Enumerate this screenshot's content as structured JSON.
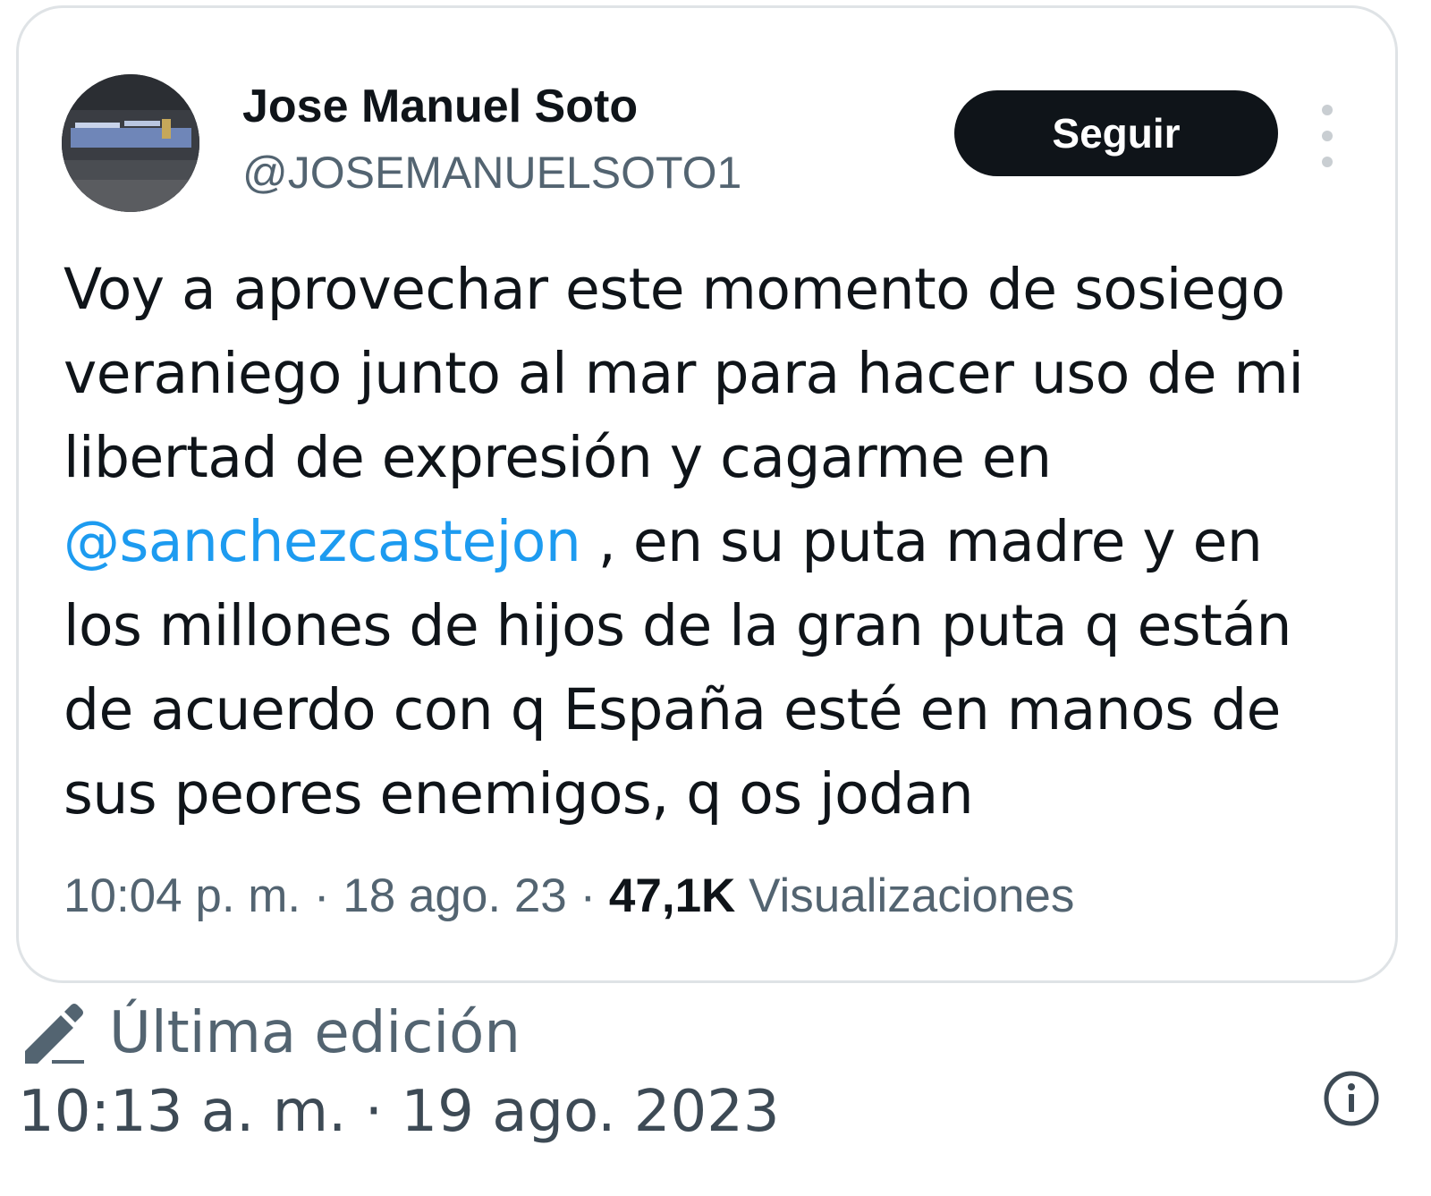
{
  "tweet": {
    "author": {
      "display_name": "Jose Manuel Soto",
      "handle": "@JOSEMANUELSOTO1",
      "avatar_icon": "avatar-photo"
    },
    "follow_button_label": "Seguir",
    "more_icon": "more-vertical-icon",
    "text": {
      "before_mention": "Voy a aprovechar este momento de sosiego veraniego junto al mar para hacer uso de mi libertad de expresión y cagarme en ",
      "mention": "@sanchezcastejon",
      "after_mention": " , en su puta madre y en los millones de hijos de la gran puta q están de acuerdo con q España esté en manos de sus peores enemigos, q os jodan"
    },
    "meta": {
      "time": "10:04 p. m.",
      "separator": " · ",
      "date": "18 ago. 23",
      "views_count": "47,1K",
      "views_label": "Visualizaciones"
    }
  },
  "edit_info": {
    "icon": "pencil-edit-icon",
    "label": "Última edición",
    "timestamp": "10:13 a. m. · 19 ago. 2023",
    "info_icon": "info-circle-icon"
  },
  "colors": {
    "text_primary": "#0f1419",
    "text_secondary": "#536471",
    "mention_blue": "#1d9bf0",
    "button_bg": "#0f1419",
    "card_border": "#dfe3e6"
  }
}
